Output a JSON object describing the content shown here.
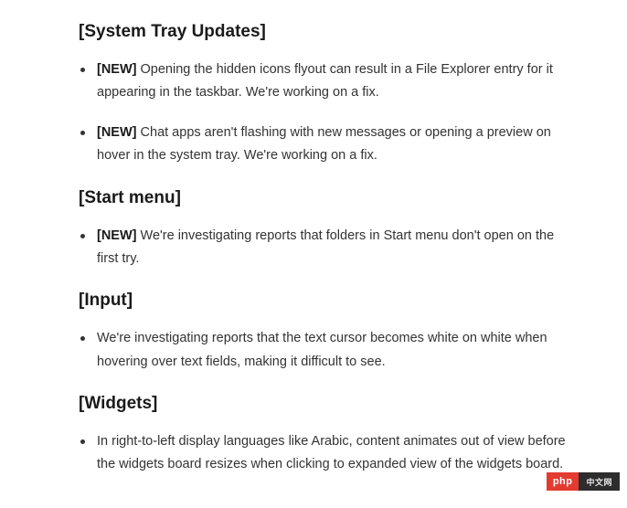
{
  "sections": [
    {
      "heading": "[System Tray Updates]",
      "items": [
        {
          "tag": "[NEW]",
          "text": " Opening the hidden icons flyout can result in a File Explorer entry for it appearing in the taskbar. We're working on a fix."
        },
        {
          "tag": "[NEW]",
          "text": " Chat apps aren't flashing with new messages or opening a preview on hover in the system tray. We're working on a fix."
        }
      ]
    },
    {
      "heading": "[Start menu]",
      "items": [
        {
          "tag": "[NEW]",
          "text": " We're investigating reports that folders in Start menu don't open on the first try."
        }
      ]
    },
    {
      "heading": "[Input]",
      "items": [
        {
          "tag": "",
          "text": "We're investigating reports that the text cursor becomes white on white when hovering over text fields, making it difficult to see."
        }
      ]
    },
    {
      "heading": "[Widgets]",
      "items": [
        {
          "tag": "",
          "text": "In right-to-left display languages like Arabic, content animates out of view before the widgets board resizes when clicking to expanded view of the widgets board."
        }
      ]
    }
  ],
  "watermark": {
    "left": "php",
    "right": "中文网"
  }
}
